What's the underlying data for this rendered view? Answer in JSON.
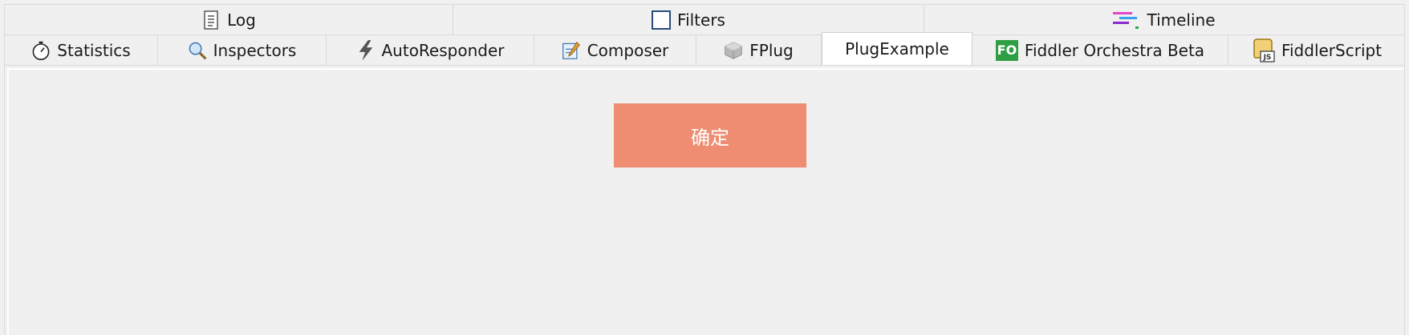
{
  "top_tabs": [
    {
      "label": "Log",
      "icon": "document-icon"
    },
    {
      "label": "Filters",
      "icon": "checkbox-icon"
    },
    {
      "label": "Timeline",
      "icon": "timeline-icon"
    }
  ],
  "tabs": [
    {
      "label": "Statistics",
      "icon": "stopwatch-icon"
    },
    {
      "label": "Inspectors",
      "icon": "magnifier-icon"
    },
    {
      "label": "AutoResponder",
      "icon": "lightning-icon"
    },
    {
      "label": "Composer",
      "icon": "pencil-icon"
    },
    {
      "label": "FPlug",
      "icon": "cube-icon"
    },
    {
      "label": "PlugExample",
      "icon": null,
      "active": true
    },
    {
      "label": "Fiddler Orchestra Beta",
      "icon": "fo-icon",
      "icon_text": "FO"
    },
    {
      "label": "FiddlerScript",
      "icon": "script-icon",
      "icon_text": "JS"
    }
  ],
  "panel": {
    "confirm_label": "确定",
    "confirm_color": "#ee8d72"
  },
  "colors": {
    "background": "#f0f0f0",
    "active_tab": "#ffffff",
    "fo_green": "#2e9e44"
  }
}
